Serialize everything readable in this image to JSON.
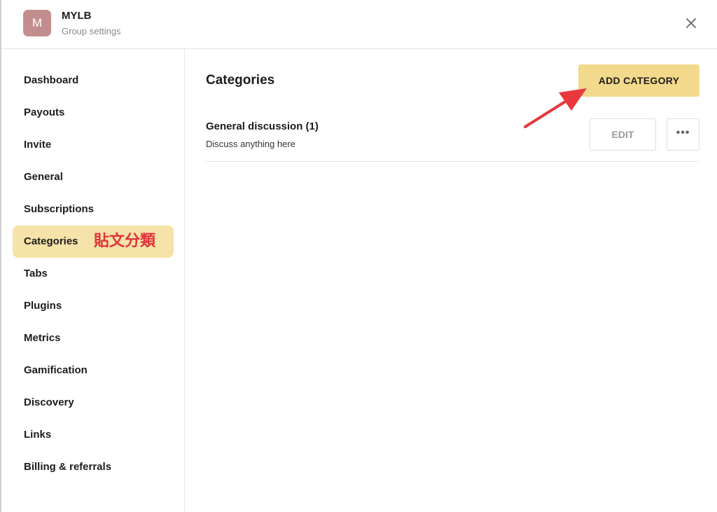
{
  "header": {
    "avatar_letter": "M",
    "group_name": "MYLB",
    "subtitle": "Group settings"
  },
  "sidebar": {
    "items": [
      {
        "label": "Dashboard"
      },
      {
        "label": "Payouts"
      },
      {
        "label": "Invite"
      },
      {
        "label": "General"
      },
      {
        "label": "Subscriptions"
      },
      {
        "label": "Categories",
        "annotation": "貼文分類"
      },
      {
        "label": "Tabs"
      },
      {
        "label": "Plugins"
      },
      {
        "label": "Metrics"
      },
      {
        "label": "Gamification"
      },
      {
        "label": "Discovery"
      },
      {
        "label": "Links"
      },
      {
        "label": "Billing & referrals"
      }
    ],
    "active_index": 5
  },
  "main": {
    "title": "Categories",
    "add_button_label": "ADD CATEGORY",
    "categories": [
      {
        "title": "General discussion (1)",
        "description": "Discuss anything here",
        "edit_label": "EDIT",
        "more_label": "•••"
      }
    ]
  },
  "colors": {
    "avatar": "#c48d8d",
    "accent": "#f3d98b",
    "active_nav": "#f6e3a8",
    "annotation": "#e2323b"
  }
}
